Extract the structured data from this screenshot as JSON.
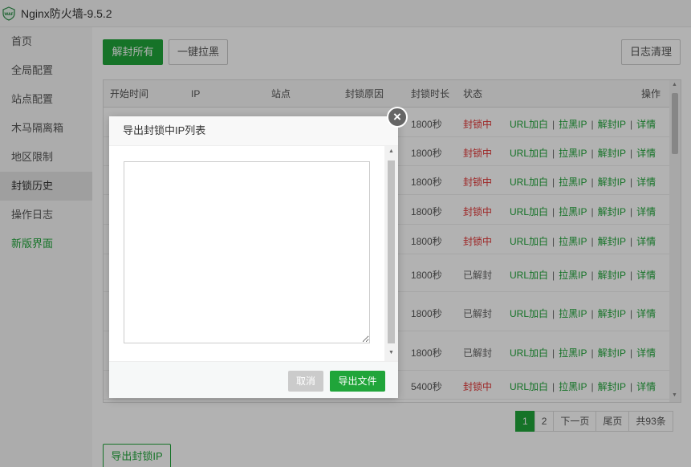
{
  "window": {
    "title": "Nginx防火墙-9.5.2",
    "logo_text": "WAF"
  },
  "sidebar": {
    "items": [
      {
        "label": "首页"
      },
      {
        "label": "全局配置"
      },
      {
        "label": "站点配置"
      },
      {
        "label": "木马隔离箱"
      },
      {
        "label": "地区限制"
      },
      {
        "label": "封锁历史"
      },
      {
        "label": "操作日志"
      },
      {
        "label": "新版界面"
      }
    ],
    "active_index": 5
  },
  "toolbar": {
    "unblock_all": "解封所有",
    "block_one_click": "一键拉黑",
    "clear_log": "日志清理"
  },
  "table": {
    "headers": {
      "start_time": "开始时间",
      "ip": "IP",
      "site": "站点",
      "reason": "封锁原因",
      "duration": "封锁时长",
      "status": "状态",
      "actions": "操作"
    },
    "action_labels": [
      "URL加白",
      "拉黑IP",
      "解封IP",
      "详情"
    ],
    "rows": [
      {
        "duration": "1800秒",
        "status": "封锁中",
        "blocked": true
      },
      {
        "duration": "1800秒",
        "status": "封锁中",
        "blocked": true
      },
      {
        "duration": "1800秒",
        "status": "封锁中",
        "blocked": true
      },
      {
        "duration": "1800秒",
        "status": "封锁中",
        "blocked": true
      },
      {
        "duration": "1800秒",
        "status": "封锁中",
        "blocked": true
      },
      {
        "duration": "1800秒",
        "status": "已解封",
        "blocked": false
      },
      {
        "duration": "1800秒",
        "status": "已解封",
        "blocked": false
      },
      {
        "duration": "1800秒",
        "status": "已解封",
        "blocked": false
      },
      {
        "duration": "5400秒",
        "status": "封锁中",
        "blocked": true
      }
    ]
  },
  "pagination": {
    "pages": [
      "1",
      "2"
    ],
    "current": "1",
    "next": "下一页",
    "last": "尾页",
    "total": "共93条"
  },
  "footer": {
    "export_blocked_ip": "导出封锁IP"
  },
  "dialog": {
    "title": "导出封锁中IP列表",
    "textarea_value": "",
    "cancel": "取消",
    "export_file": "导出文件",
    "close_glyph": "×"
  },
  "colors": {
    "accent": "#20a53a",
    "blocked": "#e13434",
    "unblocked": "#666666"
  }
}
